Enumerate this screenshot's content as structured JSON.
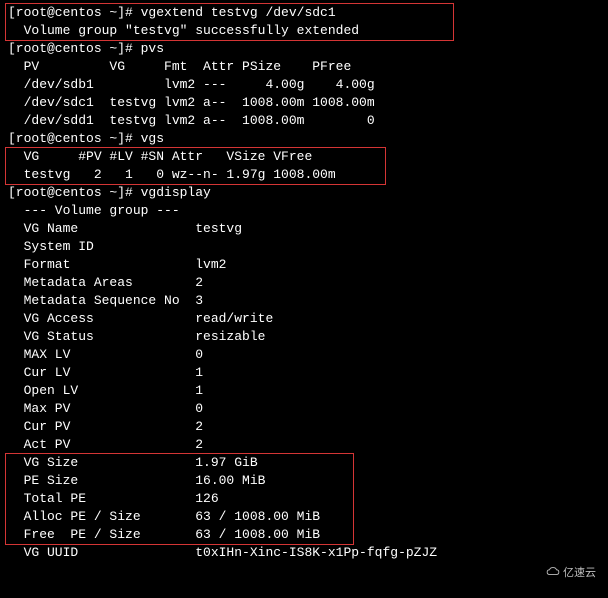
{
  "block1": {
    "l1": "[root@centos ~]# vgextend testvg /dev/sdc1",
    "l2": "  Volume group \"testvg\" successfully extended"
  },
  "cmd_pvs": "[root@centos ~]# pvs",
  "pvs": {
    "hdr": "  PV         VG     Fmt  Attr PSize    PFree",
    "r1": "  /dev/sdb1         lvm2 ---     4.00g    4.00g",
    "r2": "  /dev/sdc1  testvg lvm2 a--  1008.00m 1008.00m",
    "r3": "  /dev/sdd1  testvg lvm2 a--  1008.00m        0"
  },
  "cmd_vgs": "[root@centos ~]# vgs",
  "vgs": {
    "hdr": "  VG     #PV #LV #SN Attr   VSize VFree",
    "r1": "  testvg   2   1   0 wz--n- 1.97g 1008.00m"
  },
  "cmd_vgdisp": "[root@centos ~]# vgdisplay",
  "vgdisp": {
    "hdr": "  --- Volume group ---",
    "name": "  VG Name               testvg",
    "sysid": "  System ID",
    "fmt": "  Format                lvm2",
    "mareas": "  Metadata Areas        2",
    "mseq": "  Metadata Sequence No  3",
    "access": "  VG Access             read/write",
    "status": "  VG Status             resizable",
    "maxlv": "  MAX LV                0",
    "curlv": "  Cur LV                1",
    "openlv": "  Open LV               1",
    "maxpv": "  Max PV                0",
    "curpv": "  Cur PV                2",
    "actpv": "  Act PV                2"
  },
  "block3": {
    "vgsize": "  VG Size               1.97 GiB",
    "pesize": "  PE Size               16.00 MiB",
    "totalpe": "  Total PE              126",
    "alloc": "  Alloc PE / Size       63 / 1008.00 MiB",
    "free": "  Free  PE / Size       63 / 1008.00 MiB"
  },
  "vguuid": "  VG UUID               t0xIHn-Xinc-IS8K-x1Pp-fqfg-pZJZ",
  "watermark": "亿速云"
}
